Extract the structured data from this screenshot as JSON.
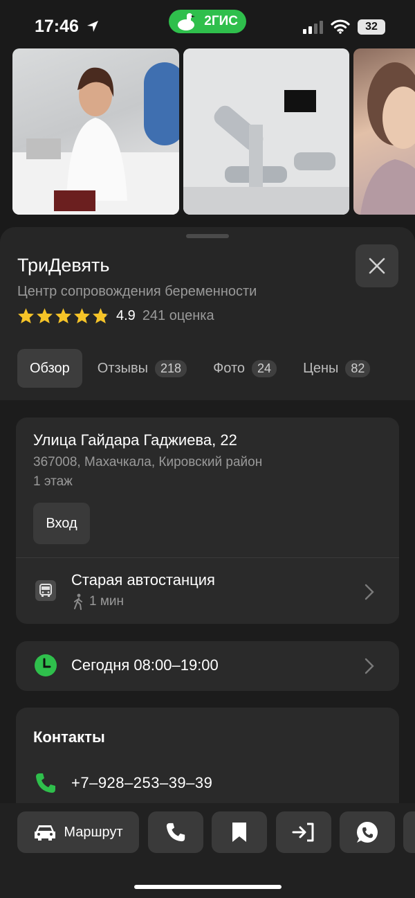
{
  "status_bar": {
    "time": "17:46",
    "brand": "2ГИС",
    "battery": "32",
    "brand_color": "#2fbf4c"
  },
  "photos": [
    {
      "name": "doctor-photo"
    },
    {
      "name": "clinic-room-photo"
    },
    {
      "name": "woman-portrait-photo"
    }
  ],
  "place": {
    "title": "ТриДевять",
    "subtitle": "Центр сопровождения беременности",
    "rating": "4.9",
    "stars_filled": 4.9,
    "rating_count": "241 оценка"
  },
  "tabs": [
    {
      "label": "Обзор",
      "badge": ""
    },
    {
      "label": "Отзывы",
      "badge": "218"
    },
    {
      "label": "Фото",
      "badge": "24"
    },
    {
      "label": "Цены",
      "badge": "82"
    }
  ],
  "address": {
    "main": "Улица Гайдара Гаджиева, 22",
    "sub": "367008, Махачкала, Кировский район",
    "floor": "1 этаж",
    "entrance_label": "Вход"
  },
  "transit": {
    "stop": "Старая автостанция",
    "walk": "1 мин",
    "icon": "bus-icon"
  },
  "hours": {
    "text": "Сегодня 08:00–19:00",
    "status_color": "#2fbf4c"
  },
  "contacts": {
    "title": "Контакты",
    "phone": "+7‒928‒253‒39‒39",
    "phone_icon_color": "#2fbf4c"
  },
  "actions": {
    "route_label": "Маршрут",
    "icons": [
      "phone-icon",
      "bookmark-icon",
      "enter-icon",
      "whatsapp-icon"
    ]
  }
}
